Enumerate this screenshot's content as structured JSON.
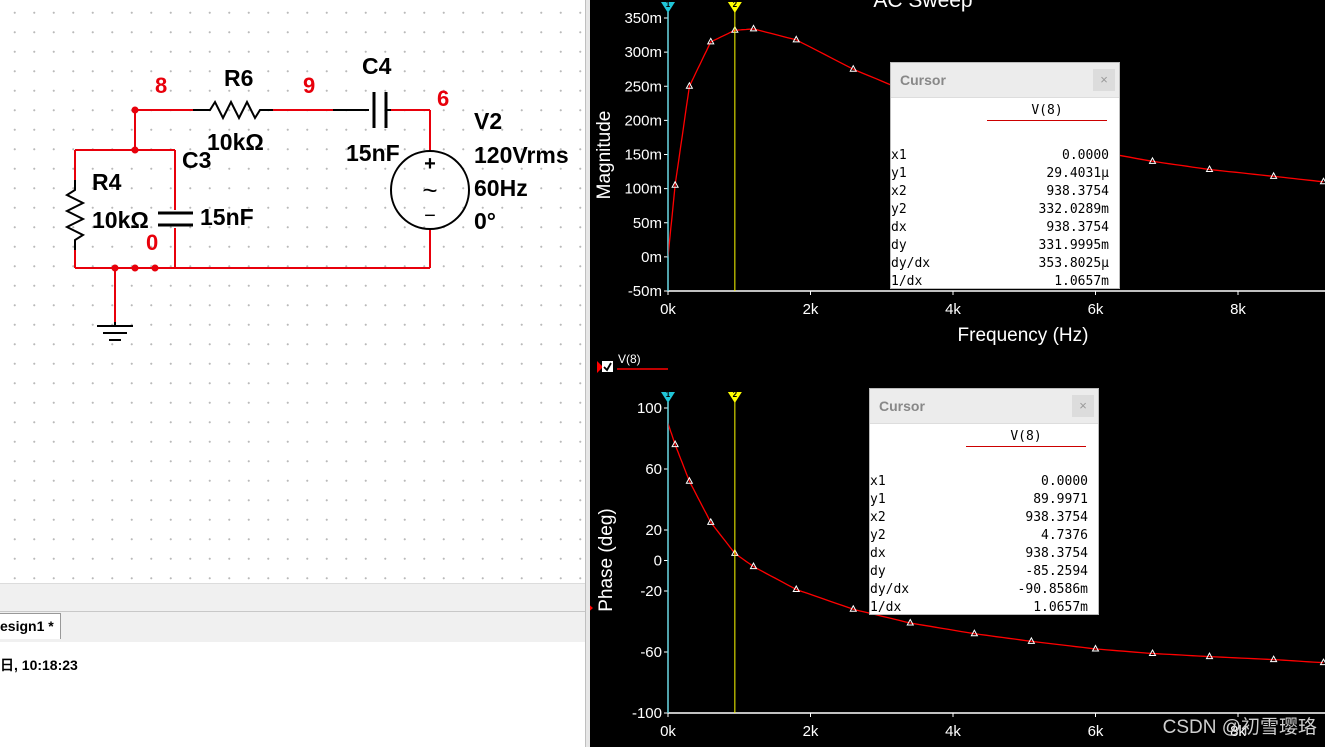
{
  "schematic": {
    "nodes": {
      "n8": "8",
      "n9": "9",
      "n6": "6",
      "n0": "0"
    },
    "r6": {
      "name": "R6",
      "value": "10kΩ"
    },
    "r4": {
      "name": "R4",
      "value": "10kΩ"
    },
    "c4": {
      "name": "C4",
      "value": "15nF"
    },
    "c3": {
      "name": "C3",
      "value": "15nF"
    },
    "v2": {
      "name": "V2",
      "amp": "120Vrms",
      "freq": "60Hz",
      "phase": "0°"
    },
    "source_symbols": {
      "plus": "+",
      "tilde": "~",
      "minus": "−"
    }
  },
  "tab": {
    "label": "esign1 *"
  },
  "status": {
    "text": "日, 10:18:23"
  },
  "colors": {
    "wire": "#e8000b",
    "trace": "#ff0000",
    "cursor1": "#20c6d8",
    "cursor2": "#ffff00",
    "plot_bg": "#000000"
  },
  "magnitude_plot": {
    "title": "AC Sweep",
    "ylabel": "Magnitude",
    "xlabel": "Frequency (Hz)",
    "y_ticks": [
      "350m",
      "300m",
      "250m",
      "200m",
      "150m",
      "100m",
      "50m",
      "0m",
      "-50m"
    ],
    "x_ticks": [
      "0k",
      "2k",
      "4k",
      "6k",
      "8k"
    ],
    "cursor1_label": "1",
    "cursor2_label": "2"
  },
  "phase_plot": {
    "legend": "V(8)",
    "ylabel": "Phase (deg)",
    "y_ticks": [
      "100",
      "60",
      "20",
      "0",
      "-20",
      "-60",
      "-100"
    ],
    "x_ticks": [
      "0k",
      "2k",
      "4k",
      "6k",
      "8k"
    ],
    "cursor1_label": "1",
    "cursor2_label": "2"
  },
  "cursor_mag": {
    "title": "Cursor",
    "close": "×",
    "column": "V(8)",
    "rows": [
      {
        "k": "x1",
        "v": "0.0000"
      },
      {
        "k": "y1",
        "v": "29.4031µ"
      },
      {
        "k": "x2",
        "v": "938.3754"
      },
      {
        "k": "y2",
        "v": "332.0289m"
      },
      {
        "k": "dx",
        "v": "938.3754"
      },
      {
        "k": "dy",
        "v": "331.9995m"
      },
      {
        "k": "dy/dx",
        "v": "353.8025µ"
      },
      {
        "k": "1/dx",
        "v": "1.0657m"
      }
    ]
  },
  "cursor_phase": {
    "title": "Cursor",
    "close": "×",
    "column": "V(8)",
    "rows": [
      {
        "k": "x1",
        "v": "0.0000"
      },
      {
        "k": "y1",
        "v": "89.9971"
      },
      {
        "k": "x2",
        "v": "938.3754"
      },
      {
        "k": "y2",
        "v": "4.7376"
      },
      {
        "k": "dx",
        "v": "938.3754"
      },
      {
        "k": "dy",
        "v": "-85.2594"
      },
      {
        "k": "dy/dx",
        "v": "-90.8586m"
      },
      {
        "k": "1/dx",
        "v": "1.0657m"
      }
    ]
  },
  "chart_data": [
    {
      "type": "line",
      "title": "AC Sweep",
      "xlabel": "Frequency (Hz)",
      "ylabel": "Magnitude",
      "xlim": [
        0,
        9200
      ],
      "ylim": [
        -0.05,
        0.35
      ],
      "series": [
        {
          "name": "V(8)",
          "x": [
            0,
            100,
            300,
            600,
            938,
            1200,
            1800,
            2600,
            3400,
            4300,
            5100,
            6000,
            6800,
            7600,
            8500,
            9200
          ],
          "values": [
            0.0,
            0.105,
            0.25,
            0.315,
            0.332,
            0.334,
            0.318,
            0.275,
            0.24,
            0.205,
            0.176,
            0.155,
            0.14,
            0.128,
            0.118,
            0.11
          ]
        }
      ],
      "cursors": [
        0,
        938.3754
      ]
    },
    {
      "type": "line",
      "xlabel": "",
      "ylabel": "Phase (deg)",
      "xlim": [
        0,
        9200
      ],
      "ylim": [
        -100,
        100
      ],
      "series": [
        {
          "name": "V(8)",
          "x": [
            0,
            100,
            300,
            600,
            938,
            1200,
            1800,
            2600,
            3400,
            4300,
            5100,
            6000,
            6800,
            7600,
            8500,
            9200
          ],
          "values": [
            90,
            76,
            52,
            25,
            4.7,
            -4,
            -19,
            -32,
            -41,
            -48,
            -53,
            -58,
            -61,
            -63,
            -65,
            -67
          ]
        }
      ],
      "cursors": [
        0,
        938.3754
      ]
    }
  ]
}
